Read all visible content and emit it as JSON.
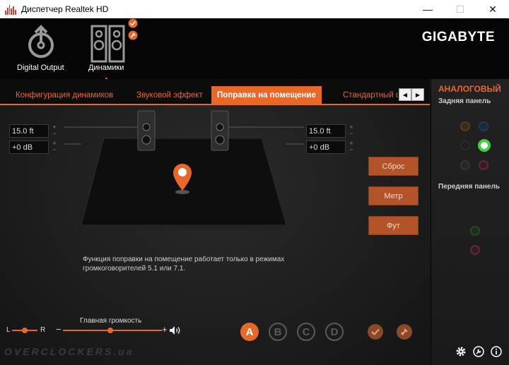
{
  "window": {
    "title": "Диспетчер Realtek HD",
    "minimize": "—",
    "maximize": "☐",
    "close": "✕"
  },
  "devices": [
    {
      "label": "Digital Output",
      "icon": "digital-output-icon"
    },
    {
      "label": "Динамики",
      "icon": "speakers-icon"
    }
  ],
  "brand": "GIGABYTE",
  "tabs": [
    {
      "label": "Конфигурация динамиков"
    },
    {
      "label": "Звуковой эффект"
    },
    {
      "label": "Поправка на помещение",
      "active": true
    },
    {
      "label": "Стандартный ф"
    }
  ],
  "room": {
    "left_distance": "15.0 ft",
    "left_gain": "+0 dB",
    "right_distance": "15.0 ft",
    "right_gain": "+0 dB",
    "buttons": {
      "reset": "Сброс",
      "meter": "Метр",
      "feet": "Фут"
    },
    "info": "Функция поправки на помещение работает только в режимах громкоговорителей 5.1 или 7.1."
  },
  "volume": {
    "label": "Главная громкость",
    "balance_left": "L",
    "balance_right": "R",
    "minus": "−",
    "plus": "+"
  },
  "profiles": [
    "A",
    "B",
    "C",
    "D"
  ],
  "right_panel": {
    "title": "АНАЛОГОВЫЙ",
    "rear": "Задняя панель",
    "front": "Передняя панель"
  },
  "watermark": "OVERCLOCKERS.ua",
  "colors": {
    "accent": "#e8682a",
    "panel": "#1d1d1d"
  }
}
